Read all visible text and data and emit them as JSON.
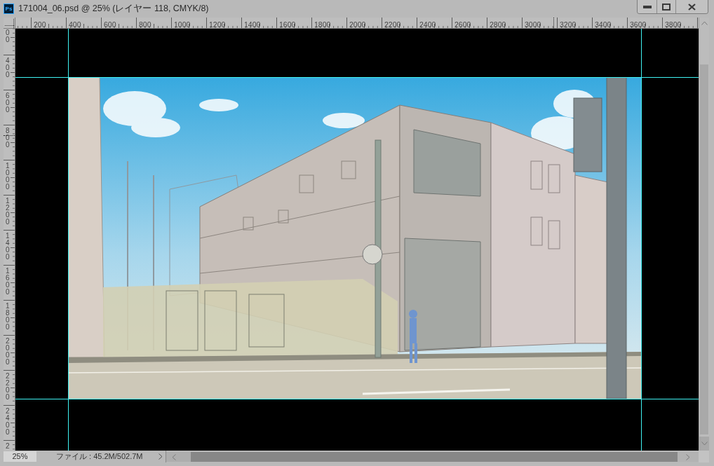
{
  "window": {
    "app_logo": "Ps",
    "title": "171004_06.psd @ 25% (レイヤー 118, CMYK/8)"
  },
  "rulers": {
    "horizontal": [
      "200",
      "400",
      "600",
      "800",
      "1000",
      "1200",
      "1400",
      "1600",
      "1800",
      "2000",
      "2200",
      "2400",
      "2600",
      "2800",
      "3000",
      "3200",
      "3400",
      "3600",
      "3800"
    ],
    "vertical": [
      "00",
      "400",
      "600",
      "800",
      "1000",
      "1200",
      "1400",
      "1600",
      "1800",
      "2000",
      "2200",
      "2400",
      "2"
    ]
  },
  "status_bar": {
    "zoom": "25%",
    "file_info": "ファイル : 45.2M/502.7M"
  }
}
